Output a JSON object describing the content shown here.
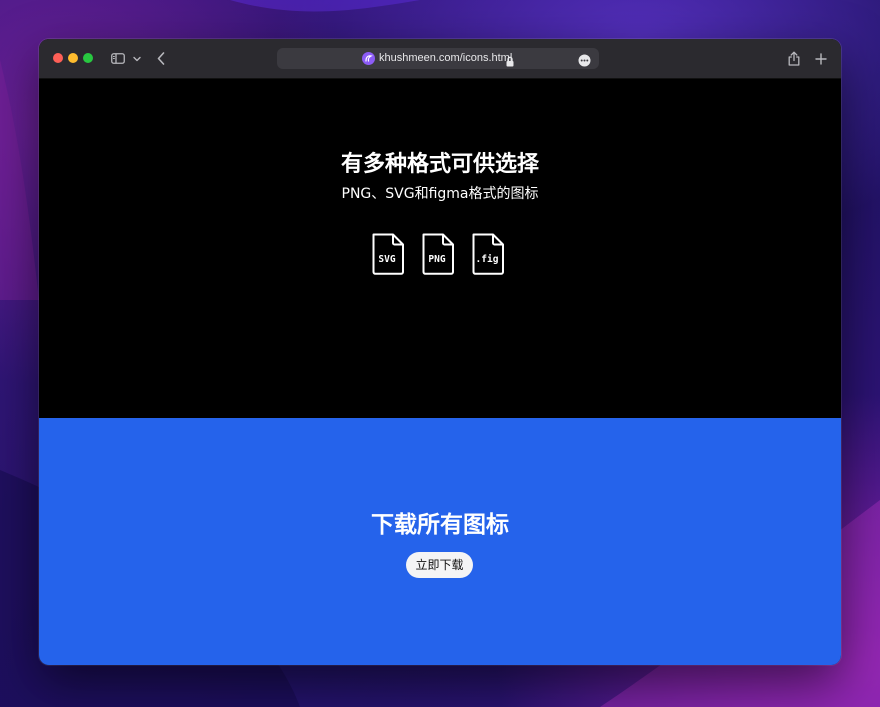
{
  "browser": {
    "url": "khushmeen.com/icons.html",
    "icons": {
      "sidebar": "sidebar-icon",
      "sidebar_menu": "chevron-down-icon",
      "back": "chevron-left-icon",
      "site": "site-favicon-icon",
      "lock": "lock-icon",
      "more": "ellipsis-circle-icon",
      "share": "share-icon",
      "new_tab": "plus-icon"
    }
  },
  "hero": {
    "title": "有多种格式可供选择",
    "subtitle": "PNG、SVG和figma格式的图标",
    "formats": [
      {
        "label": "SVG",
        "icon": "svg-file-icon"
      },
      {
        "label": "PNG",
        "icon": "png-file-icon"
      },
      {
        "label": ".fig",
        "icon": "fig-file-icon"
      }
    ]
  },
  "download": {
    "title": "下载所有图标",
    "button_label": "立即下载"
  },
  "colors": {
    "hero_background": "#000000",
    "download_background": "#2563eb",
    "button_background": "#f4f4f5",
    "toolbar_background": "#2b2a2f"
  }
}
